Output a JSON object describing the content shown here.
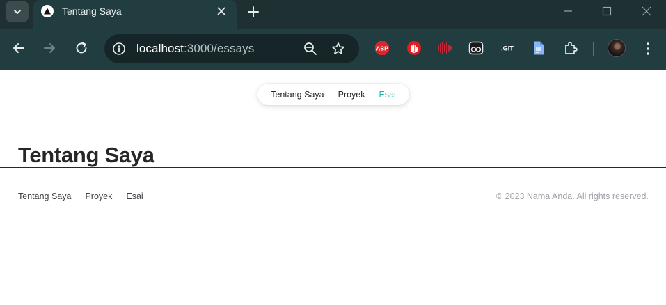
{
  "browser": {
    "tab": {
      "title": "Tentang Saya"
    },
    "url": {
      "host": "localhost",
      "port": ":3000",
      "path": "/essays"
    },
    "extensions": [
      "abp-icon",
      "ublock-icon",
      "audio-icon",
      "reader-icon",
      "git-icon",
      "doc-icon",
      "puzzle-icon"
    ],
    "ext_labels": {
      "abp": "ABP",
      "git": ".GIT"
    }
  },
  "nav": {
    "items": [
      {
        "label": "Tentang Saya",
        "active": false
      },
      {
        "label": "Proyek",
        "active": false
      },
      {
        "label": "Esai",
        "active": true
      }
    ]
  },
  "main": {
    "heading": "Tentang Saya"
  },
  "footer": {
    "links": [
      "Tentang Saya",
      "Proyek",
      "Esai"
    ],
    "copyright": "© 2023 Nama Anda. All rights reserved."
  },
  "colors": {
    "accent": "#14b8a6",
    "chrome": "#213d40",
    "text": "#27272a"
  }
}
